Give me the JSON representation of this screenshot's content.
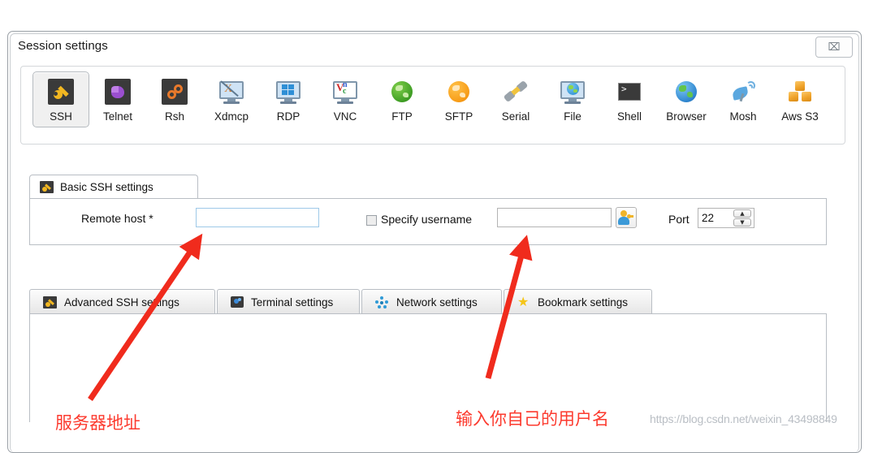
{
  "window": {
    "title": "Session settings",
    "close_label": "⌧",
    "close_icon": "close-icon"
  },
  "toolbar": {
    "protocols": [
      {
        "label": "SSH",
        "icon": "ssh-key-icon",
        "selected": true
      },
      {
        "label": "Telnet",
        "icon": "telnet-gem-icon",
        "selected": false
      },
      {
        "label": "Rsh",
        "icon": "rsh-gears-icon",
        "selected": false
      },
      {
        "label": "Xdmcp",
        "icon": "xdmcp-monitor-icon",
        "selected": false
      },
      {
        "label": "RDP",
        "icon": "rdp-windows-icon",
        "selected": false
      },
      {
        "label": "VNC",
        "icon": "vnc-monitor-icon",
        "selected": false
      },
      {
        "label": "FTP",
        "icon": "ftp-globe-icon",
        "selected": false
      },
      {
        "label": "SFTP",
        "icon": "sftp-globe-icon",
        "selected": false
      },
      {
        "label": "Serial",
        "icon": "serial-plug-icon",
        "selected": false
      },
      {
        "label": "File",
        "icon": "file-monitor-icon",
        "selected": false
      },
      {
        "label": "Shell",
        "icon": "shell-prompt-icon",
        "selected": false
      },
      {
        "label": "Browser",
        "icon": "browser-globe-icon",
        "selected": false
      },
      {
        "label": "Mosh",
        "icon": "mosh-dish-icon",
        "selected": false
      },
      {
        "label": "Aws S3",
        "icon": "aws-s3-cubes-icon",
        "selected": false
      }
    ]
  },
  "basic_settings": {
    "tab_label": "Basic SSH settings",
    "tab_icon": "key-icon",
    "remote_host_label": "Remote host *",
    "remote_host_value": "",
    "remote_host_placeholder": "",
    "specify_username_label": "Specify username",
    "specify_username_checked": false,
    "username_value": "",
    "username_placeholder": "",
    "user_picker_icon": "user-picker-icon",
    "port_label": "Port",
    "port_value": "22",
    "spinner_up": "▲",
    "spinner_down": "▼"
  },
  "lower_tabs": [
    {
      "label": "Advanced SSH settings",
      "icon": "key-icon"
    },
    {
      "label": "Terminal settings",
      "icon": "terminal-icon"
    },
    {
      "label": "Network settings",
      "icon": "network-icon"
    },
    {
      "label": "Bookmark settings",
      "icon": "star-icon"
    }
  ],
  "annotations": {
    "arrow_color": "#f02b1d",
    "remote_host_note": "服务器地址",
    "username_note": "输入你自己的用户名"
  },
  "watermark": {
    "text": "https://blog.csdn.net/weixin_43498849"
  }
}
